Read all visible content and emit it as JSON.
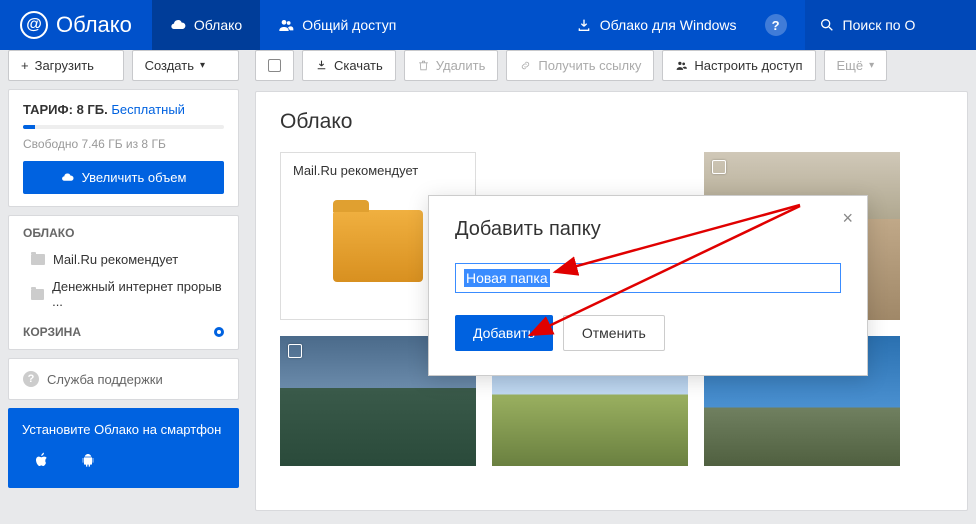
{
  "header": {
    "logo": "Облако",
    "nav": [
      {
        "label": "Облако",
        "icon": "cloud-icon"
      },
      {
        "label": "Общий доступ",
        "icon": "people-icon"
      }
    ],
    "download_link": "Облако для Windows",
    "search_placeholder": "Поиск по О"
  },
  "sidebar": {
    "upload_label": "Загрузить",
    "create_label": "Создать",
    "tariff": {
      "prefix": "ТАРИФ:",
      "size": "8 ГБ.",
      "link": "Бесплатный"
    },
    "free_space": "Свободно 7.46 ГБ из 8 ГБ",
    "increase_label": "Увеличить объем",
    "section_cloud": "ОБЛАКО",
    "items": [
      "Mail.Ru рекомендует",
      "Денежный интернет прорыв ..."
    ],
    "section_trash": "КОРЗИНА",
    "support": "Служба поддержки",
    "install": "Установите Облако на смартфон"
  },
  "main": {
    "toolbar": {
      "download": "Скачать",
      "delete": "Удалить",
      "get_link": "Получить ссылку",
      "configure": "Настроить доступ",
      "more": "Ещё"
    },
    "title": "Облако",
    "tiles": [
      {
        "label": "Mail.Ru рекомендует",
        "type": "folder"
      }
    ]
  },
  "modal": {
    "title": "Добавить папку",
    "input_value": "Новая папка",
    "submit": "Добавить",
    "cancel": "Отменить"
  }
}
